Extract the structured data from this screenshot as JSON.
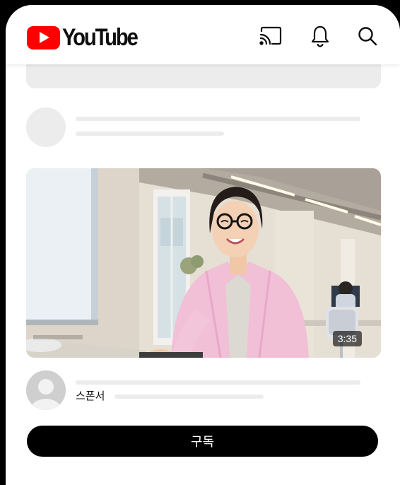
{
  "header": {
    "logo_text": "YouTube",
    "icons": [
      "cast-icon",
      "bell-icon",
      "search-icon"
    ]
  },
  "video": {
    "duration": "3:35"
  },
  "channel": {
    "sponsor_label": "스폰서"
  },
  "actions": {
    "subscribe_label": "구독"
  },
  "colors": {
    "brand_red": "#ff0000",
    "placeholder_gray": "#ececec",
    "button_black": "#000000"
  }
}
